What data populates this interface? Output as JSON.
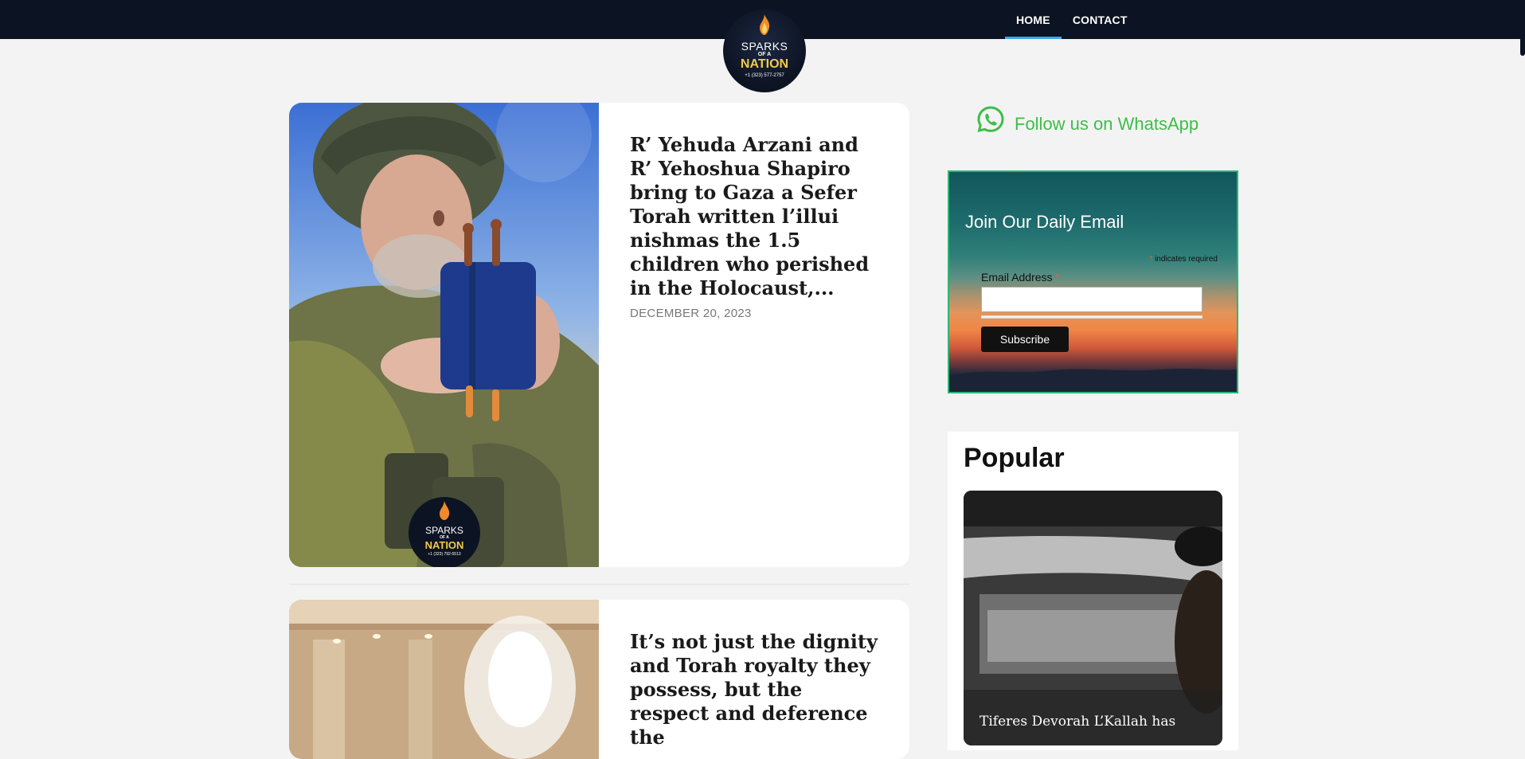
{
  "nav": {
    "items": [
      {
        "label": "HOME",
        "active": true
      },
      {
        "label": "CONTACT",
        "active": false
      }
    ]
  },
  "logo": {
    "line1": "SPARKS",
    "line2": "OF A",
    "line3": "NATION",
    "phone": "+1 (323) 577-2757"
  },
  "posts": [
    {
      "title": "R’ Yehuda Arzani and R’ Yehoshua Shapiro bring to Gaza a Sefer Torah written l’illui nishmas the 1.5 children who perished in the Holocaust,...",
      "date": "DECEMBER 20, 2023",
      "image": {
        "watermark": {
          "line1": "SPARKS",
          "line2": "OF A",
          "line3": "NATION",
          "phone": "+1 (323) 792-5513"
        }
      }
    },
    {
      "title": "It’s not just the dignity and Torah royalty they possess, but the respect and deference the",
      "date": ""
    }
  ],
  "sidebar": {
    "whatsapp": {
      "label": "Follow us on WhatsApp",
      "icon": "whatsapp-icon",
      "color": "#3fbd4a"
    },
    "newsletter": {
      "title": "Join Our Daily Email",
      "required_note": "indicates required",
      "email_label": "Email Address",
      "email_value": "",
      "button_label": "Subscribe"
    },
    "popular": {
      "heading": "Popular",
      "item_caption": "Tiferes Devorah L’Kallah has"
    }
  },
  "colors": {
    "nav_bg": "#0c1322",
    "active_underline": "#3ba9f2",
    "page_bg": "#f3f3f3",
    "whatsapp_green": "#3fbd4a",
    "newsletter_border": "#2bb673"
  }
}
